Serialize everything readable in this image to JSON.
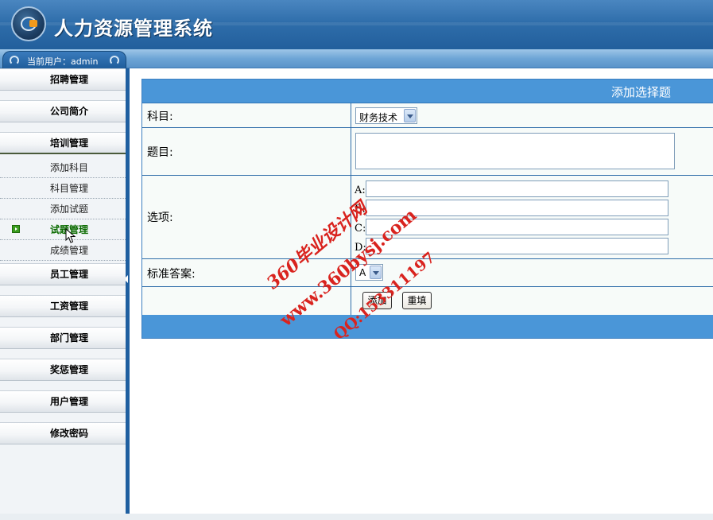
{
  "app": {
    "title": "人力资源管理系统",
    "current_user_label": "当前用户：admin"
  },
  "sidebar": {
    "items": [
      {
        "label": "招聘管理"
      },
      {
        "label": "公司简介"
      },
      {
        "label": "培训管理"
      },
      {
        "label": "员工管理"
      },
      {
        "label": "工资管理"
      },
      {
        "label": "部门管理"
      },
      {
        "label": "奖惩管理"
      },
      {
        "label": "用户管理"
      },
      {
        "label": "修改密码"
      }
    ],
    "training_subitems": [
      {
        "label": "添加科目"
      },
      {
        "label": "科目管理"
      },
      {
        "label": "添加试题"
      },
      {
        "label": "试题管理"
      },
      {
        "label": "成绩管理"
      }
    ]
  },
  "form": {
    "title": "添加选择题",
    "subject_label": "科目:",
    "subject_value": "财务技术",
    "question_label": "题目:",
    "options_label": "选项:",
    "option_letters": [
      "A:",
      "B:",
      "C:",
      "D:"
    ],
    "answer_label": "标准答案:",
    "answer_value": "A",
    "add_button": "添加",
    "reset_button": "重填"
  },
  "watermark": {
    "line1": "360毕业设计网",
    "line2": "www.360bysj.com",
    "line3": "QQ:153311197"
  },
  "colors": {
    "header_blue": "#2f6eab",
    "form_bar_blue": "#4a96d8",
    "watermark_red": "#d9231e",
    "active_green": "#0b6b00"
  }
}
